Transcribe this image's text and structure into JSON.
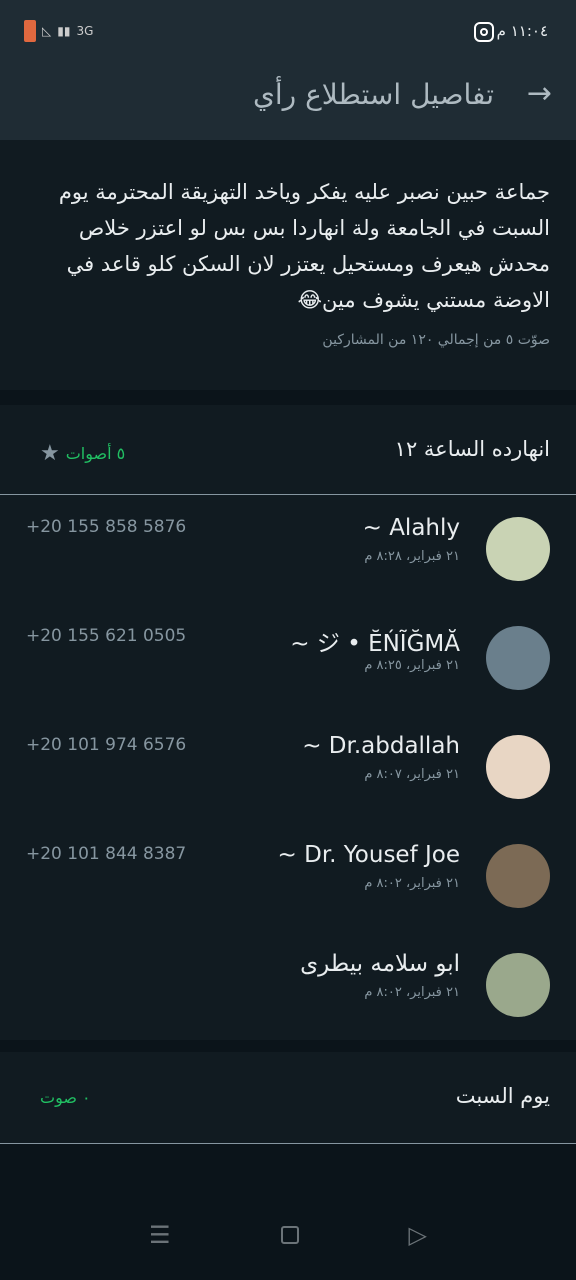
{
  "status_bar": {
    "time": "١١:٠٤ م",
    "network": "3G"
  },
  "header": {
    "title": "تفاصيل استطلاع رأي"
  },
  "poll": {
    "question": "جماعة حبين نصبر عليه يفكر ويا‌خد التهزيقة المحترمة يوم السبت في الجامعة ولة انهاردا بس بس لو اعتزر خلاص محدش هيعرف ومستحيل يعتزر لان السكن كلو قاعد في الاوضة مستني يشوف مين😂",
    "summary": "صوّت ٥ من إجمالي ١٢٠ من المشاركين"
  },
  "options": [
    {
      "label": "انهارده الساعة ١٢",
      "votes": "٥ أصوات",
      "voters": [
        {
          "name": "~ Alahly",
          "date": "٢١ فبراير، ٨:٢٨ م",
          "phone": "+20 155 858 5876",
          "avatar_color": "#c9d3b4"
        },
        {
          "name": "~ ジ • ĔŃĨĞMĂ",
          "date": "٢١ فبراير، ٨:٢٥ م",
          "phone": "+20 155 621 0505",
          "avatar_color": "#6a7f8c"
        },
        {
          "name": "~ Dr.abdallah",
          "date": "٢١ فبراير، ٨:٠٧ م",
          "phone": "+20 101 974 6576",
          "avatar_color": "#e8d6c4"
        },
        {
          "name": "~ Dr. Yousef Joe",
          "date": "٢١ فبراير، ٨:٠٢ م",
          "phone": "+20 101 844 8387",
          "avatar_color": "#7c6a55"
        },
        {
          "name": "ابو سلامه بيطرى",
          "date": "٢١ فبراير، ٨:٠٢ م",
          "phone": "",
          "avatar_color": "#9aa88c"
        }
      ]
    },
    {
      "label": "يوم السبت",
      "votes": "٠ صوت"
    }
  ],
  "colors": {
    "accent": "#21c063",
    "header_bg": "#1f2c34",
    "body_bg": "#111b21"
  }
}
